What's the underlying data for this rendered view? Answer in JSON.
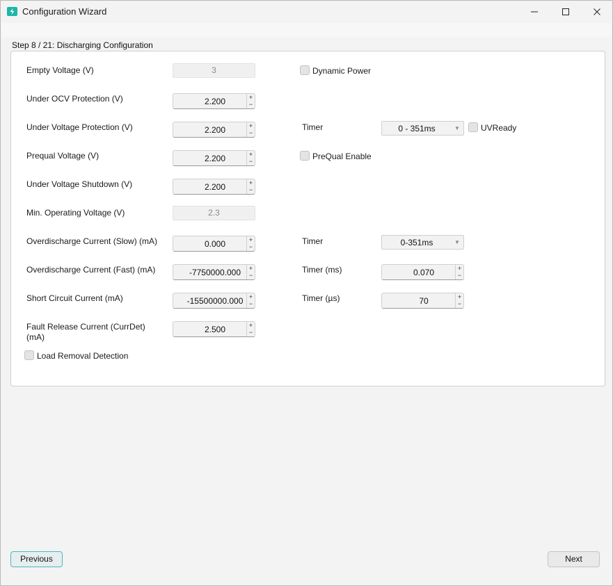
{
  "window": {
    "title": "Configuration Wizard",
    "controls": {
      "minimize": "─",
      "maximize": "☐",
      "close": "✕"
    }
  },
  "step": {
    "title": "Step 8 / 21: Discharging Configuration"
  },
  "fields": {
    "empty_voltage": {
      "label": "Empty Voltage (V)",
      "value": "3"
    },
    "under_ocv": {
      "label": "Under OCV Protection (V)",
      "value": "2.200"
    },
    "under_voltage_prot": {
      "label": "Under Voltage Protection (V)",
      "value": "2.200"
    },
    "prequal_voltage": {
      "label": "Prequal Voltage (V)",
      "value": "2.200"
    },
    "under_voltage_shutdown": {
      "label": "Under Voltage Shutdown (V)",
      "value": "2.200"
    },
    "min_operating": {
      "label": "Min. Operating Voltage (V)",
      "value": "2.3"
    },
    "od_slow": {
      "label": "Overdischarge Current (Slow) (mA)",
      "value": "0.000"
    },
    "od_fast": {
      "label": "Overdischarge Current (Fast) (mA)",
      "value": "-7750000.000"
    },
    "short_circuit": {
      "label": "Short Circuit Current (mA)",
      "value": "-15500000.000"
    },
    "fault_release": {
      "label_line1": "Fault Release Current (CurrDet)",
      "label_line2": "(mA)",
      "value": "2.500"
    }
  },
  "right": {
    "dynamic_power": {
      "label": "Dynamic Power",
      "checked": false
    },
    "uv_timer": {
      "label": "Timer",
      "value": "0 - 351ms"
    },
    "uvready": {
      "label": "UVReady",
      "checked": false
    },
    "prequal_enable": {
      "label": "PreQual Enable",
      "checked": false
    },
    "od_slow_timer": {
      "label": "Timer",
      "value": "0-351ms"
    },
    "od_fast_timer": {
      "label": "Timer (ms)",
      "value": "0.070"
    },
    "sc_timer": {
      "label": "Timer (µs)",
      "value": "70"
    }
  },
  "load_removal": {
    "label": "Load Removal Detection",
    "checked": false
  },
  "spin_glyphs": {
    "up": "+",
    "down": "−"
  },
  "combo_glyph": "▼",
  "buttons": {
    "previous": "Previous",
    "next": "Next"
  },
  "colors": {
    "accent": "#1fb5a8",
    "previous_border": "#4db6c2"
  }
}
